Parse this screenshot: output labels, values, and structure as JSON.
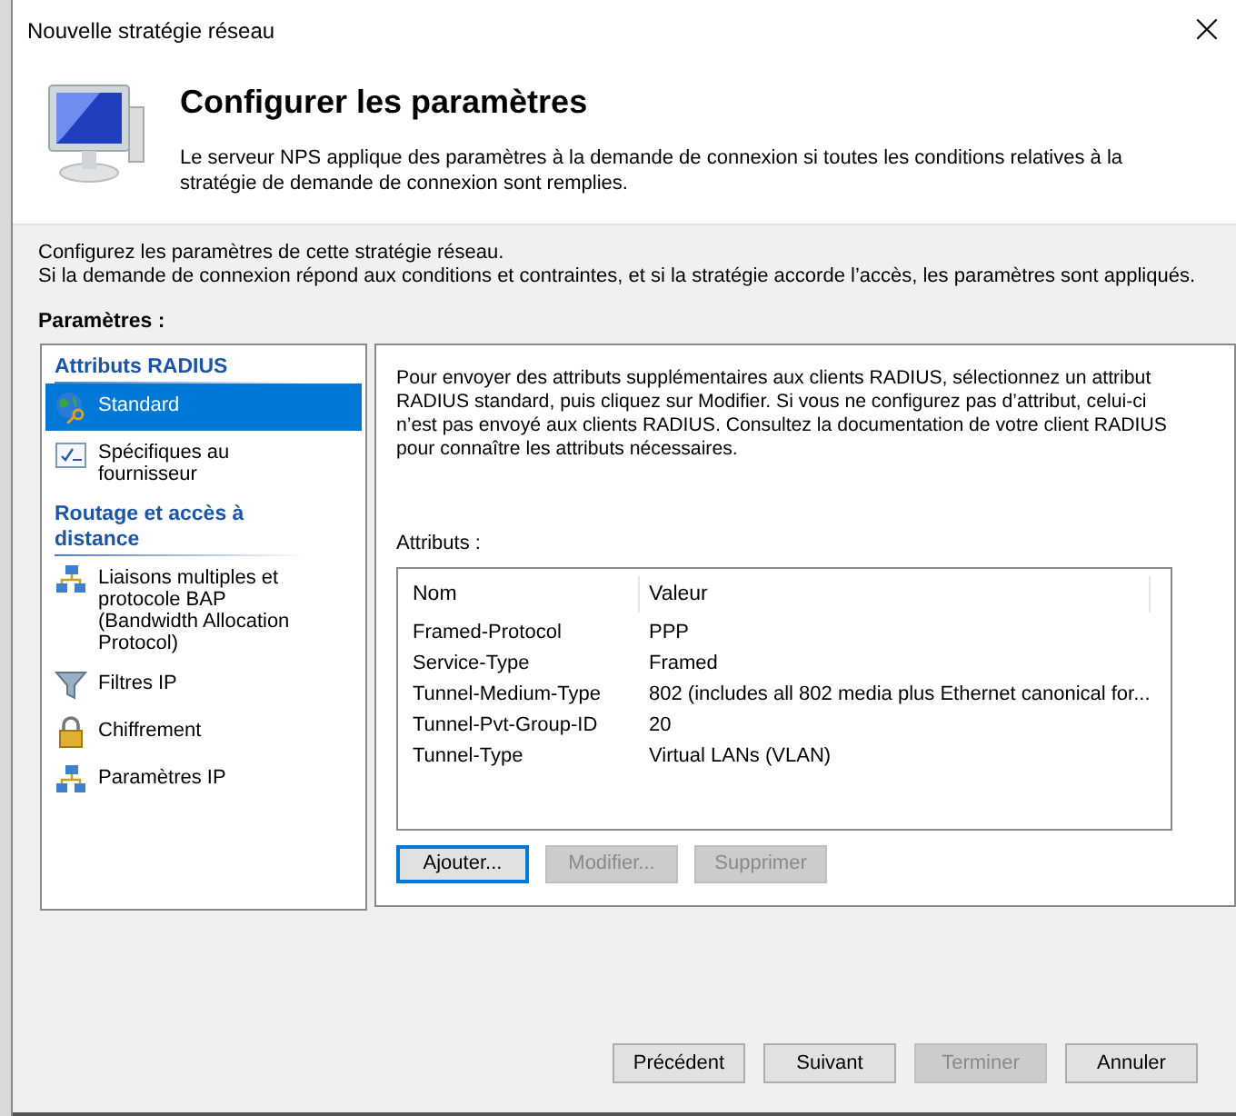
{
  "window": {
    "title": "Nouvelle stratégie réseau",
    "close": "×"
  },
  "header": {
    "title": "Configurer les paramètres",
    "description": "Le serveur NPS applique des paramètres à la demande de connexion si toutes les conditions relatives à la stratégie de demande de connexion sont remplies."
  },
  "intro": [
    "Configurez les paramètres de cette stratégie réseau.",
    "Si la demande de connexion répond aux conditions et contraintes, et si la stratégie accorde l’accès, les paramètres sont appliqués."
  ],
  "settings_label": "Paramètres :",
  "sidebar": {
    "sections": [
      {
        "title": "Attributs RADIUS",
        "items": [
          {
            "label": "Standard",
            "kind": "globe",
            "selected": true
          },
          {
            "label": "Spécifiques au fournisseur",
            "kind": "checklist",
            "selected": false
          }
        ]
      },
      {
        "title": "Routage et accès à distance",
        "items": [
          {
            "label": "Liaisons multiples et protocole BAP (Bandwidth Allocation Protocol)",
            "kind": "network",
            "selected": false
          },
          {
            "label": "Filtres IP",
            "kind": "filter",
            "selected": false
          },
          {
            "label": "Chiffrement",
            "kind": "lock",
            "selected": false
          },
          {
            "label": "Paramètres IP",
            "kind": "network",
            "selected": false
          }
        ]
      }
    ]
  },
  "panel": {
    "description": "Pour envoyer des attributs supplémentaires aux clients RADIUS, sélectionnez un attribut RADIUS standard, puis cliquez sur Modifier. Si vous ne configurez pas d’attribut, celui-ci n’est pas envoyé aux clients RADIUS. Consultez la documentation de votre client RADIUS pour connaître les attributs nécessaires.",
    "attributes_label": "Attributs :",
    "table": {
      "columns": [
        "Nom",
        "Valeur"
      ],
      "rows": [
        [
          "Framed-Protocol",
          "PPP"
        ],
        [
          "Service-Type",
          "Framed"
        ],
        [
          "Tunnel-Medium-Type",
          "802 (includes all 802 media plus Ethernet canonical for..."
        ],
        [
          "Tunnel-Pvt-Group-ID",
          "20"
        ],
        [
          "Tunnel-Type",
          "Virtual LANs (VLAN)"
        ]
      ]
    },
    "buttons": [
      {
        "label": "Ajouter...",
        "disabled": false,
        "focused": true
      },
      {
        "label": "Modifier...",
        "disabled": true,
        "focused": false
      },
      {
        "label": "Supprimer",
        "disabled": true,
        "focused": false
      }
    ]
  },
  "footer_buttons": [
    {
      "label": "Précédent",
      "disabled": false
    },
    {
      "label": "Suivant",
      "disabled": false
    },
    {
      "label": "Terminer",
      "disabled": true
    },
    {
      "label": "Annuler",
      "disabled": false
    }
  ]
}
